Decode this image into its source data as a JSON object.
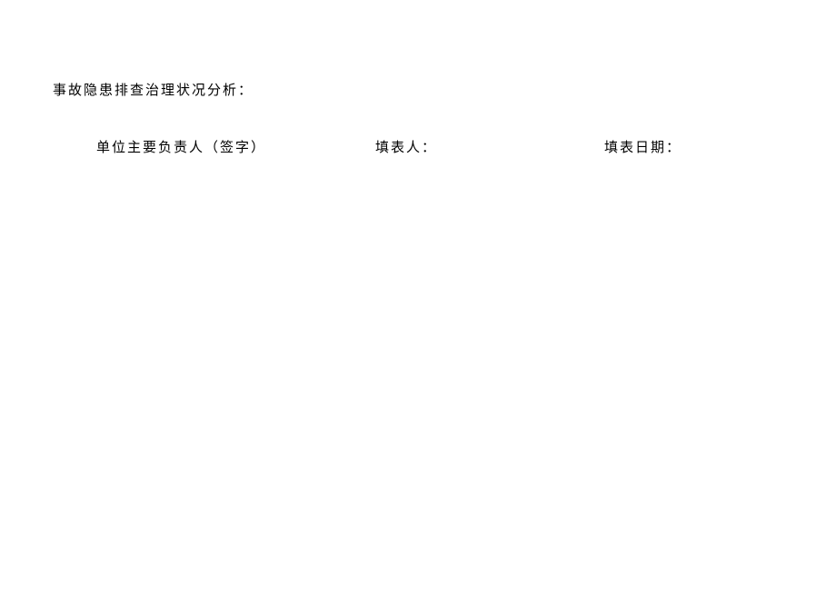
{
  "document": {
    "section_title": "事故隐患排查治理状况分析：",
    "signatures": {
      "responsible_person_label": "单位主要负责人（签字）",
      "preparer_label": "填表人：",
      "date_label": "填表日期："
    }
  }
}
